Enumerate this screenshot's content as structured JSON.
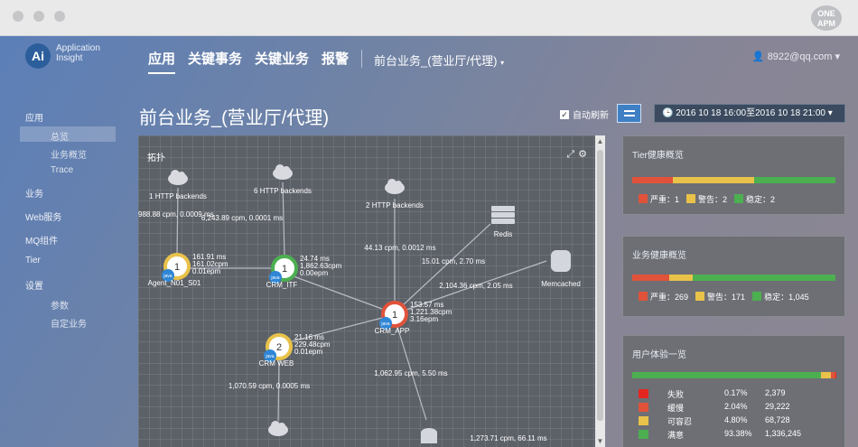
{
  "brand": {
    "label": "ONE APM"
  },
  "logo": {
    "mark": "Ai",
    "line1": "Application",
    "line2": "Insight"
  },
  "nav": {
    "tabs": [
      "应用",
      "关键事务",
      "关键业务",
      "报警"
    ],
    "context": "前台业务_(营业厅/代理)",
    "user": "8922@qq.com"
  },
  "sidebar": {
    "items": [
      "应用",
      "业务",
      "Web服务",
      "MQ组件",
      "Tier",
      "设置"
    ],
    "app_sub": [
      "总览",
      "业务概览",
      "Trace"
    ],
    "settings_sub": [
      "参数",
      "自定业务"
    ]
  },
  "page": {
    "title": "前台业务_(营业厅/代理)",
    "auto_refresh": "自动刷新",
    "time_range": "2016 10 18 16:00至2016 10 18 21:00"
  },
  "topology": {
    "title": "拓扑",
    "clouds": [
      "1 HTTP backends",
      "6 HTTP backends",
      "2 HTTP backends"
    ],
    "services": [
      "Redis",
      "Memcached"
    ],
    "nodes": [
      {
        "name": "Agent_N01_S01",
        "count": "1",
        "m1": "161.91 ms",
        "m2": "161.02cpm",
        "m3": "0.01epm",
        "tag": "java"
      },
      {
        "name": "CRM_ITF",
        "count": "1",
        "m1": "24.74 ms",
        "m2": "1,862.63cpm",
        "m3": "0.00epm",
        "tag": "java"
      },
      {
        "name": "CRM_APP",
        "count": "1",
        "m1": "153.57 ms",
        "m2": "1,221.38cpm",
        "m3": "3.16epm",
        "tag": "java"
      },
      {
        "name": "CRM WEB",
        "count": "2",
        "m1": "21.16 ms",
        "m2": "229.48cpm",
        "m3": "0.01epm",
        "tag": "java"
      }
    ],
    "edges": [
      "988.88 cpm, 0.0009 ms",
      "6,243.89 cpm, 0.0001 ms",
      "44.13 cpm, 0.0012 ms",
      "15.01 cpm, 2.70 ms",
      "2,104.36 cpm, 2.05 ms",
      "1,062.95 cpm, 5.50 ms",
      "1,070.59 cpm, 0.0005 ms",
      "1,273.71 cpm, 66.11 ms"
    ]
  },
  "tier_health": {
    "title": "Tier健康概览",
    "segments": [
      {
        "label": "严重",
        "count": 1,
        "color": "#e0533a"
      },
      {
        "label": "警告",
        "count": 2,
        "color": "#e9c24a"
      },
      {
        "label": "正常",
        "count": 2,
        "color": "#4caf50"
      }
    ],
    "legend": [
      "严重：1",
      "警告：2",
      "稳定：2"
    ]
  },
  "biz_health": {
    "title": "业务健康概览",
    "segments": [
      {
        "label": "严重",
        "count": 269,
        "color": "#e0533a"
      },
      {
        "label": "警告",
        "count": 171,
        "color": "#e9c24a"
      },
      {
        "label": "正常",
        "count": 1045,
        "color": "#4caf50"
      }
    ],
    "legend": [
      "严重：269",
      "警告：171",
      "稳定：1,045"
    ]
  },
  "user_exp": {
    "title": "用户体验一览",
    "rows": [
      {
        "label": "失败",
        "pct": "0.17%",
        "count": "2,379",
        "color": "#e5261f"
      },
      {
        "label": "缓慢",
        "pct": "2.04%",
        "count": "29,222",
        "color": "#e0533a"
      },
      {
        "label": "可容忍",
        "pct": "4.80%",
        "count": "68,728",
        "color": "#e9c24a"
      },
      {
        "label": "满意",
        "pct": "93.38%",
        "count": "1,336,245",
        "color": "#4caf50"
      }
    ]
  }
}
